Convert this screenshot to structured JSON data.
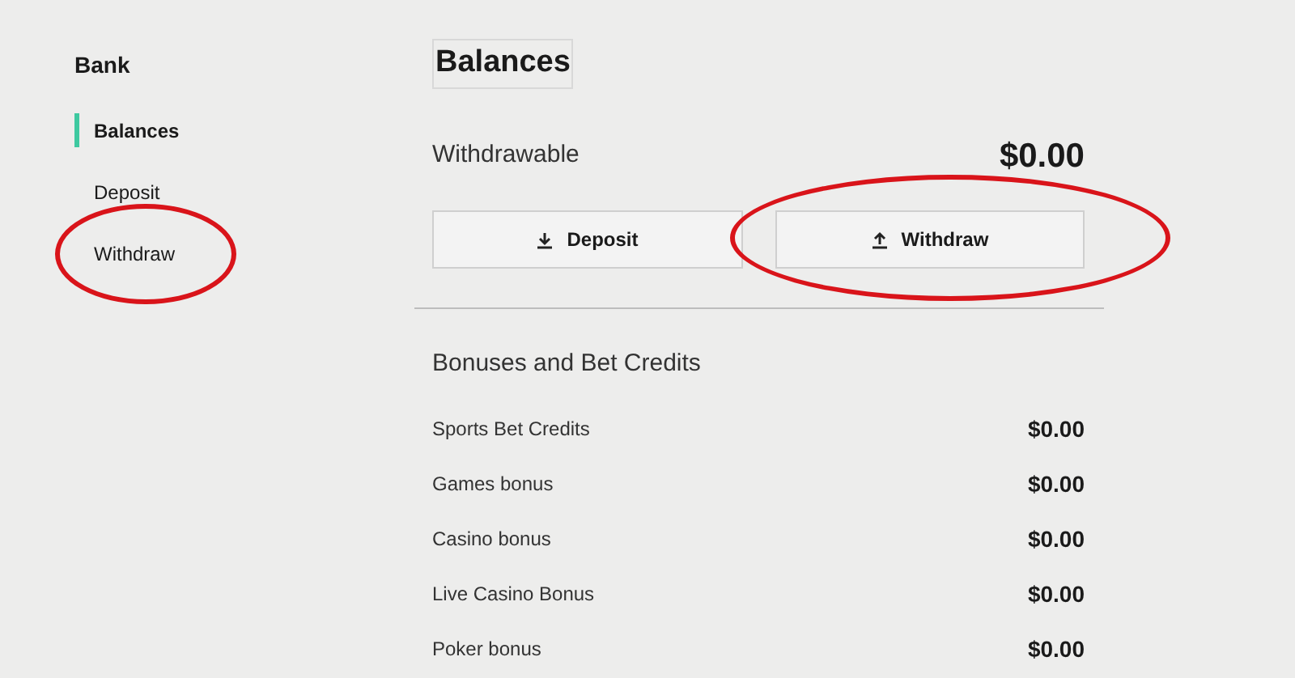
{
  "sidebar": {
    "title": "Bank",
    "items": [
      {
        "label": "Balances",
        "selected": true,
        "circled": false
      },
      {
        "label": "Deposit",
        "selected": false,
        "circled": false
      },
      {
        "label": "Withdraw",
        "selected": false,
        "circled": true
      }
    ]
  },
  "main": {
    "title": "Balances",
    "withdrawable": {
      "label": "Withdrawable",
      "amount": "$0.00"
    },
    "buttons": [
      {
        "kind": "download",
        "label": "Deposit",
        "circled": false
      },
      {
        "kind": "upload",
        "label": "Withdraw",
        "circled": true
      }
    ],
    "bonuses": {
      "title": "Bonuses and Bet Credits",
      "rows": [
        {
          "label": "Sports Bet Credits",
          "amount": "$0.00"
        },
        {
          "label": "Games bonus",
          "amount": "$0.00"
        },
        {
          "label": "Casino bonus",
          "amount": "$0.00"
        },
        {
          "label": "Live Casino Bonus",
          "amount": "$0.00"
        },
        {
          "label": "Poker bonus",
          "amount": "$0.00"
        }
      ]
    }
  }
}
